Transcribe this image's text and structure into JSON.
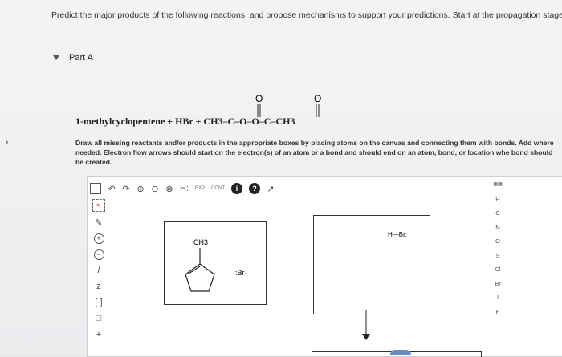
{
  "header": {
    "prompt": "Predict the major products of the following reactions, and propose mechanisms to support your predictions. Start at the propagation stage."
  },
  "part": {
    "label": "Part A"
  },
  "reaction": {
    "text": "1-methylcyclopentene  +  HBr  +  CH",
    "peroxide": "3–C–O–O–C–CH3",
    "o1": "O",
    "o2": "O"
  },
  "instructions": {
    "text": "Draw all missing reactants and/or products in the appropriate boxes by placing atoms on the canvas and connecting them with bonds. Add where needed. Electron flow arrows should start on the electron(s) of an atom or a bond and should end on an atom, bond, or location whe bond should be created."
  },
  "toolbar": {
    "undo": "↶",
    "redo": "↷",
    "zoom_in": "⊕",
    "zoom_out": "⊖",
    "zoom_fit": "⊗",
    "h_dots": "H:",
    "exp": "EXP",
    "cont": "CONT",
    "info": "i",
    "help": "?",
    "expand": "↗"
  },
  "left_tools": [
    "✎",
    "+",
    "−",
    "/",
    "z",
    "[ ]",
    "□",
    "+"
  ],
  "canvas": {
    "box1": {
      "ch3": "CH3",
      "br": ":Br·"
    },
    "box2": {
      "hbr": "H—Br:"
    }
  },
  "periodic": [
    "H",
    "C",
    "N",
    "O",
    "S",
    "Cl",
    "Br",
    "I",
    "P"
  ],
  "colors": {
    "accent": "#6d8bbd",
    "dark": "#222222",
    "red": "#c0392b"
  }
}
